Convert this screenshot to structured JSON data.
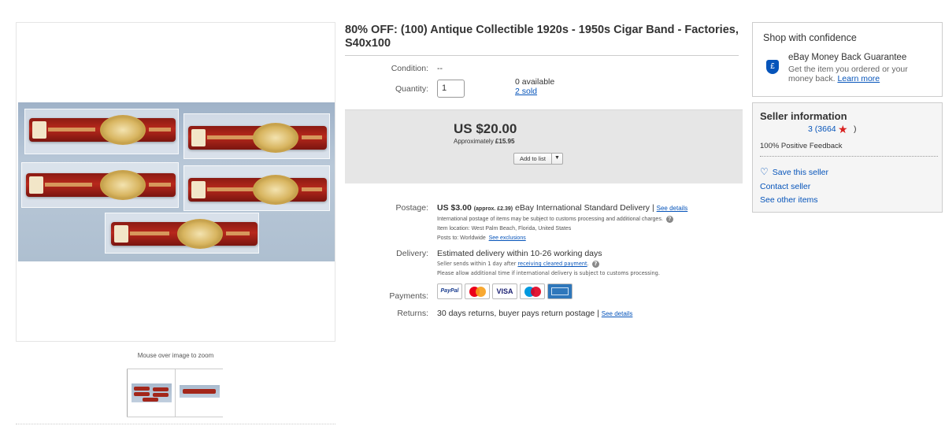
{
  "gallery": {
    "zoom_hint": "Mouse over image to zoom"
  },
  "item": {
    "title": "80% OFF: (100) Antique Collectible 1920s - 1950s Cigar Band - Factories, S40x100",
    "condition_label": "Condition:",
    "condition_value": "--",
    "quantity_label": "Quantity:",
    "quantity_value": "1",
    "available": "0 available",
    "sold": "2 sold"
  },
  "price": {
    "amount": "US $20.00",
    "approx_prefix": "Approximately",
    "approx_value": "£15.95",
    "add_to_list": "Add to list"
  },
  "postage": {
    "label": "Postage:",
    "amount": "US $3.00",
    "approx": "(approx. £2.39)",
    "service": "eBay International Standard Delivery |",
    "see_details": "See details",
    "customs_note": "International postage of items may be subject to customs processing and additional charges.",
    "item_location": "Item location:  West Palm Beach, Florida, United States",
    "posts_to": "Posts to:  Worldwide",
    "see_exclusions": "See exclusions"
  },
  "delivery": {
    "label": "Delivery:",
    "estimate": "Estimated delivery within 10-26 working days",
    "sends_prefix": "Seller sends within 1 day after",
    "sends_link": "receiving cleared payment",
    "allow_note": "Please allow additional time if international delivery is subject to customs processing."
  },
  "payments": {
    "label": "Payments:",
    "methods": [
      "PayPal",
      "Mastercard",
      "VISA",
      "Maestro",
      "American Express"
    ]
  },
  "returns": {
    "label": "Returns:",
    "text": "30 days returns, buyer pays return postage |",
    "see_details": "See details"
  },
  "confidence": {
    "title": "Shop with confidence",
    "guarantee_title": "eBay Money Back Guarantee",
    "guarantee_desc": "Get the item you ordered or your money back.",
    "learn_more": "Learn more"
  },
  "seller": {
    "title": "Seller information",
    "name_fragment": "3",
    "score": "(3664",
    "score_close": ")",
    "feedback": "100% Positive Feedback",
    "save": "Save this seller",
    "contact": "Contact seller",
    "other_items": "See other items"
  },
  "colors": {
    "link": "#0654ba",
    "price_bg": "#e6e6e6",
    "star": "#d9201f",
    "seller_bg": "#f5f5f5"
  }
}
